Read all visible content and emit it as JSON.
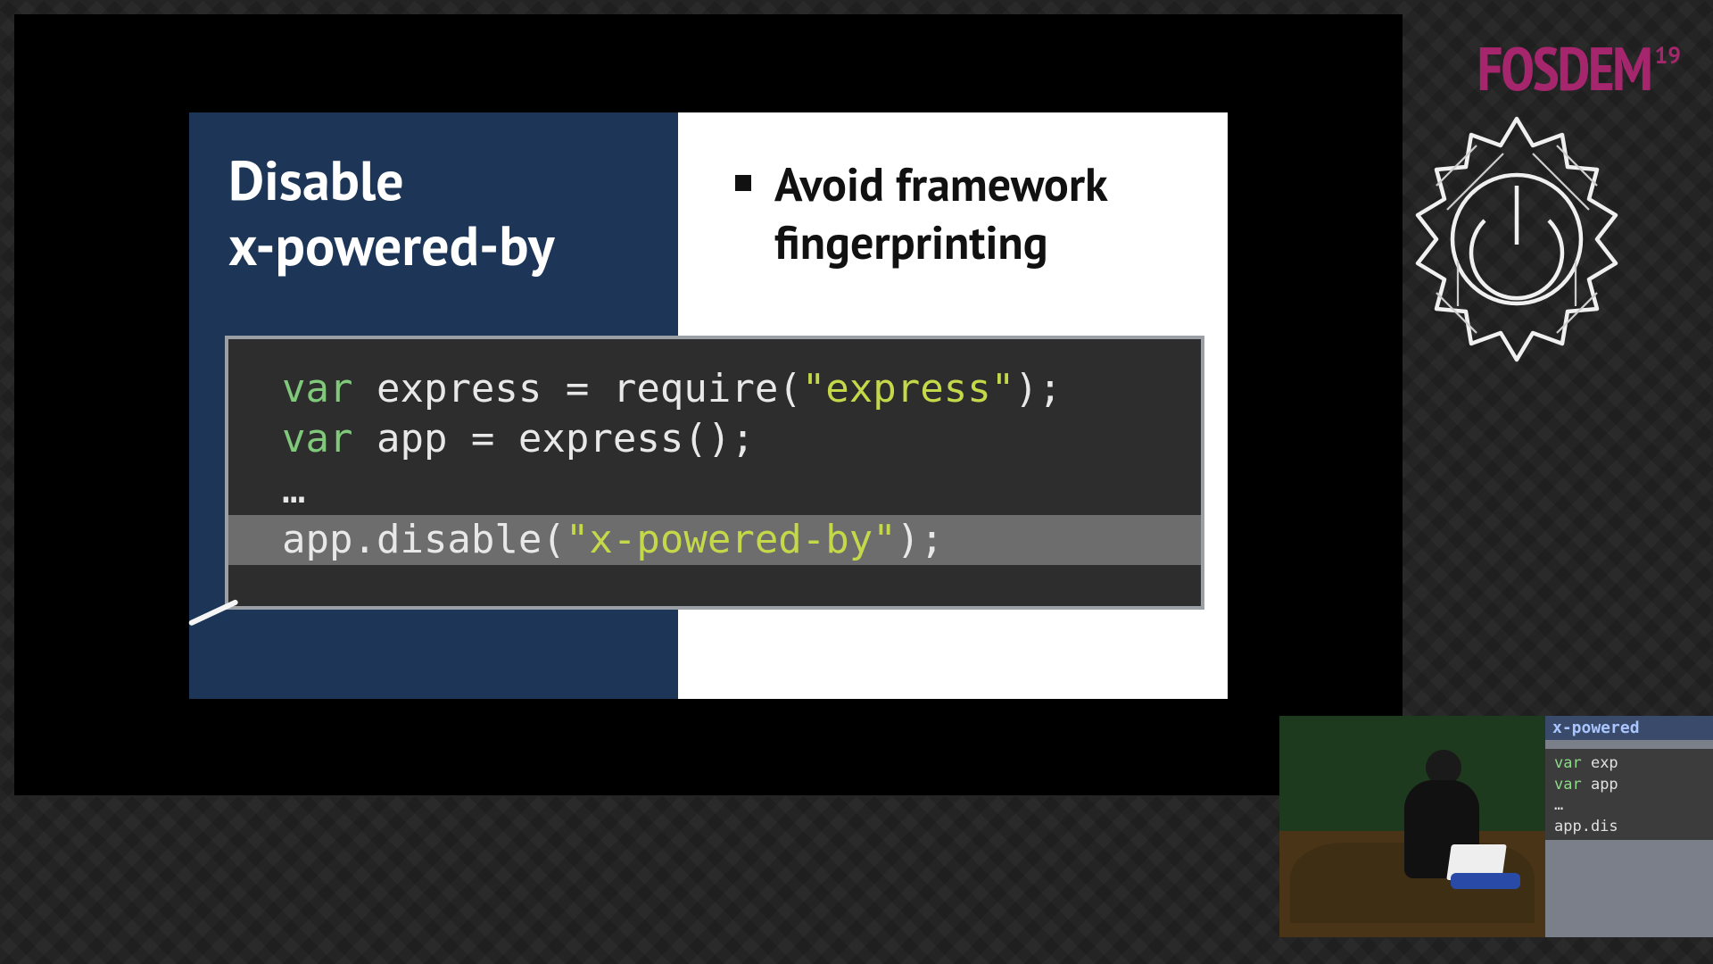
{
  "brand": {
    "word": "FOSDEM",
    "year": "19"
  },
  "slide": {
    "title_line1": "Disable",
    "title_line2": "x-powered-by",
    "bullet": "Avoid framework fingerprinting",
    "code": {
      "l1_kw": "var",
      "l1_rest": " express = require(",
      "l1_str": "\"express\"",
      "l1_end": ");",
      "l2_kw": "var",
      "l2_rest": " app = express();",
      "l3": "…",
      "l4_pre": "app.disable(",
      "l4_str": "\"x-powered-by\"",
      "l4_end": ");"
    }
  },
  "pip": {
    "title": "x-powered",
    "l1_kw": "var",
    "l1_rest": " exp",
    "l2_kw": "var",
    "l2_rest": " app",
    "l3": "…",
    "l4": "app.dis"
  }
}
